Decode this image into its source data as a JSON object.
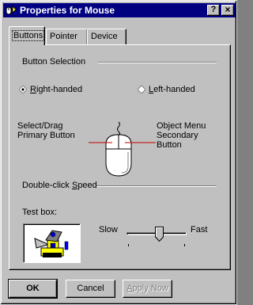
{
  "window": {
    "title": "Properties for Mouse",
    "help_label": "?",
    "close_label": "×"
  },
  "tabs": [
    {
      "label": "Buttons",
      "active": true
    },
    {
      "label": "Pointer",
      "active": false
    },
    {
      "label": "Device",
      "active": false
    }
  ],
  "button_selection": {
    "group_label": "Button Selection",
    "right_handed": {
      "prefix": "",
      "accel": "R",
      "rest": "ight-handed",
      "selected": true
    },
    "left_handed": {
      "prefix": "",
      "accel": "L",
      "rest": "eft-handed",
      "selected": false
    },
    "left_button_label_1": "Select/Drag",
    "left_button_label_2": "Primary Button",
    "right_button_label_1": "Object Menu",
    "right_button_label_2": "Secondary",
    "right_button_label_3": "Button"
  },
  "double_click": {
    "label_prefix": "Double-click ",
    "label_accel": "S",
    "label_rest": "peed",
    "test_box_label": "Test box:",
    "slow_label": "Slow",
    "fast_label": "Fast",
    "speed_level": 0.55
  },
  "footer": {
    "ok_label": "OK",
    "cancel_label": "Cancel",
    "apply_prefix": "",
    "apply_accel": "A",
    "apply_rest": "pply Now"
  },
  "colors": {
    "face": "#c0c0c0",
    "titlebar": "#000080",
    "mouse_red_line": "#c00000"
  },
  "icons": [
    "mouse-setup-icon",
    "help-icon",
    "close-icon",
    "radio-diamond-icon",
    "mouse-illustration",
    "jack-in-the-box-icon",
    "slider-thumb-icon"
  ]
}
